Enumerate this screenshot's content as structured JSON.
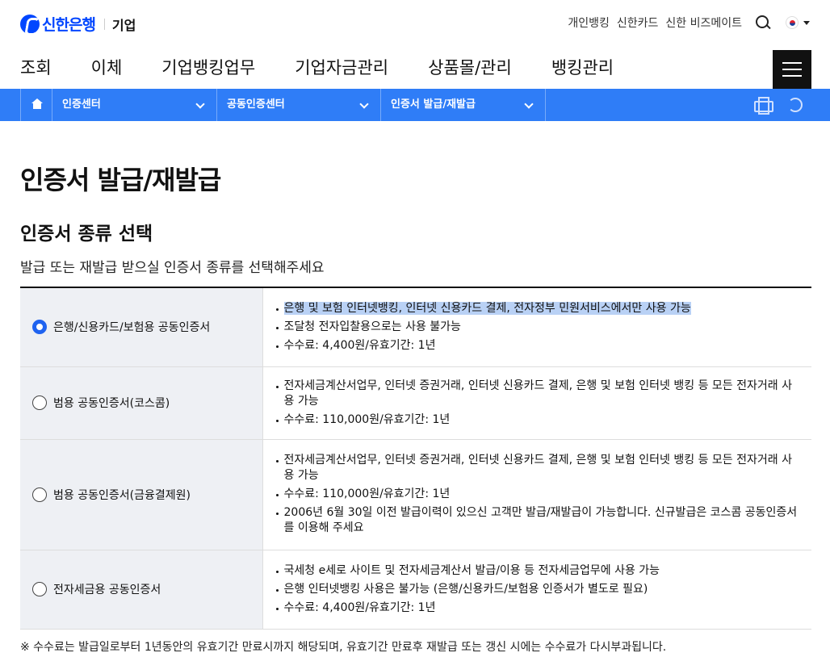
{
  "brand": {
    "name": "신한은행",
    "sub": "기업",
    "accent": "#0046ff"
  },
  "util": {
    "links": [
      "개인뱅킹",
      "신한카드",
      "신한 비즈메이트"
    ],
    "search_icon": "search-icon",
    "lang_icon": "korea-flag-icon"
  },
  "gnb": {
    "items": [
      "조회",
      "이체",
      "기업뱅킹업무",
      "기업자금관리",
      "상품몰/관리",
      "뱅킹관리"
    ]
  },
  "breadcrumb": {
    "bar_color": "#2f7df7",
    "items": [
      "인증센터",
      "공동인증센터",
      "인증서 발급/재발급"
    ]
  },
  "page": {
    "title": "인증서 발급/재발급",
    "section_title": "인증서 종류 선택",
    "section_desc": "발급 또는 재발급 받으실 인증서 종류를 선택해주세요",
    "note": "※ 수수료는 발급일로부터 1년동안의 유효기간 만료시까지 해당되며, 유효기간 만료후 재발급 또는 갱신 시에는 수수료가 다시부과됩니다."
  },
  "certs": [
    {
      "label": "은행/신용카드/보험용 공동인증서",
      "selected": true,
      "bullets": [
        "은행 및 보험 인터넷뱅킹, 인터넷 신용카드 결제, 전자정부 민원서비스에서만 사용 가능",
        "조달청 전자입찰용으로는 사용 불가능",
        "수수료: 4,400원/유효기간: 1년"
      ]
    },
    {
      "label": "범용 공동인증서(코스콤)",
      "selected": false,
      "bullets": [
        "전자세금계산서업무, 인터넷 증권거래, 인터넷 신용카드 결제, 은행 및 보험 인터넷 뱅킹 등 모든 전자거래 사용 가능",
        "수수료: 110,000원/유효기간: 1년"
      ]
    },
    {
      "label": "범용 공동인증서(금융결제원)",
      "selected": false,
      "bullets": [
        "전자세금계산서업무, 인터넷 증권거래, 인터넷 신용카드 결제, 은행 및 보험 인터넷 뱅킹 등 모든 전자거래 사용 가능",
        "수수료: 110,000원/유효기간: 1년",
        "2006년 6월 30일 이전 발급이력이 있으신 고객만 발급/재발급이 가능합니다. 신규발급은 코스콤 공동인증서를 이용해 주세요"
      ]
    },
    {
      "label": "전자세금용 공동인증서",
      "selected": false,
      "bullets": [
        "국세청 e세로 사이트 및 전자세금계산서 발급/이용 등 전자세금업무에 사용 가능",
        "은행 인터넷뱅킹 사용은 불가능 (은행/신용카드/보험용 인증서가 별도로 필요)",
        "수수료: 4,400원/유효기간: 1년"
      ]
    }
  ]
}
